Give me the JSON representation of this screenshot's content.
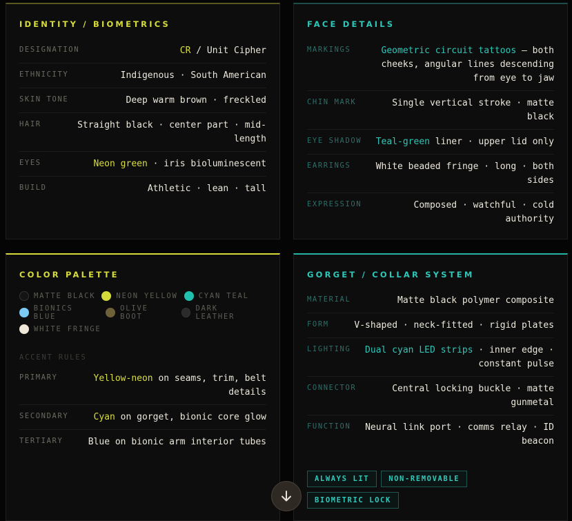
{
  "identity": {
    "title": "IDENTITY / BIOMETRICS",
    "rows": [
      {
        "label": "DESIGNATION",
        "pre": "",
        "hl": "CR",
        "post": " / Unit Cipher",
        "hl_color": "yellow"
      },
      {
        "label": "ETHNICITY",
        "pre": "Indigenous · South American",
        "hl": "",
        "post": ""
      },
      {
        "label": "SKIN TONE",
        "pre": "Deep warm brown · freckled",
        "hl": "",
        "post": ""
      },
      {
        "label": "HAIR",
        "pre": "Straight black · center part · mid-length",
        "hl": "",
        "post": ""
      },
      {
        "label": "EYES",
        "pre": "",
        "hl": "Neon green",
        "post": " · iris bioluminescent",
        "hl_color": "yellow"
      },
      {
        "label": "BUILD",
        "pre": "Athletic · lean · tall",
        "hl": "",
        "post": ""
      }
    ]
  },
  "face": {
    "title": "FACE DETAILS",
    "rows": [
      {
        "label": "MARKINGS",
        "pre": "",
        "hl": "Geometric circuit tattoos",
        "post": " — both cheeks, angular lines descending from eye to jaw",
        "hl_color": "cyan"
      },
      {
        "label": "CHIN MARK",
        "pre": "Single vertical stroke · matte black",
        "hl": "",
        "post": ""
      },
      {
        "label": "EYE SHADOW",
        "pre": "",
        "hl": "Teal-green",
        "post": " liner · upper lid only",
        "hl_color": "cyan"
      },
      {
        "label": "EARRINGS",
        "pre": "White beaded fringe · long · both sides",
        "hl": "",
        "post": ""
      },
      {
        "label": "EXPRESSION",
        "pre": "Composed · watchful · cold authority",
        "hl": "",
        "post": ""
      }
    ]
  },
  "palette": {
    "title": "COLOR PALETTE",
    "swatch_rows": [
      [
        {
          "name": "MATTE BLACK",
          "color": "#141414",
          "border": "#333333"
        },
        {
          "name": "NEON YELLOW",
          "color": "#d6dc3a",
          "border": "#d6dc3a"
        },
        {
          "name": "CYAN TEAL",
          "color": "#1fc0b0",
          "border": "#1fc0b0"
        }
      ],
      [
        {
          "name": "BIONICS BLUE",
          "color": "#7cc9f4",
          "border": "#7cc9f4"
        },
        {
          "name": "OLIVE BOOT",
          "color": "#6e6038",
          "border": "#6e6038"
        },
        {
          "name": "DARK LEATHER",
          "color": "#2b2b2b",
          "border": "#333333"
        }
      ],
      [
        {
          "name": "WHITE FRINGE",
          "color": "#efe8d8",
          "border": "#efe8d8"
        }
      ]
    ],
    "accent_heading": "ACCENT RULES",
    "rows": [
      {
        "label": "PRIMARY",
        "pre": "",
        "hl": "Yellow-neon",
        "post": " on seams, trim, belt details",
        "hl_color": "yellow"
      },
      {
        "label": "SECONDARY",
        "pre": "",
        "hl": "Cyan",
        "post": " on gorget, bionic core glow",
        "hl_color": "yellow"
      },
      {
        "label": "TERTIARY",
        "pre": "Blue on bionic arm interior tubes",
        "hl": "",
        "post": ""
      }
    ]
  },
  "gorget": {
    "title": "GORGET / COLLAR SYSTEM",
    "rows": [
      {
        "label": "MATERIAL",
        "pre": "Matte black polymer composite",
        "hl": "",
        "post": ""
      },
      {
        "label": "FORM",
        "pre": "V-shaped · neck-fitted · rigid plates",
        "hl": "",
        "post": ""
      },
      {
        "label": "LIGHTING",
        "pre": "",
        "hl": "Dual cyan LED strips",
        "post": " · inner edge · constant pulse",
        "hl_color": "cyan"
      },
      {
        "label": "CONNECTOR",
        "pre": "Central locking buckle · matte gunmetal",
        "hl": "",
        "post": ""
      },
      {
        "label": "FUNCTION",
        "pre": "Neural link port · comms relay · ID beacon",
        "hl": "",
        "post": ""
      }
    ],
    "badges": [
      "ALWAYS LIT",
      "NON-REMOVABLE",
      "BIOMETRIC LOCK"
    ]
  },
  "scroll_button": {
    "icon": "arrow-down-icon"
  }
}
